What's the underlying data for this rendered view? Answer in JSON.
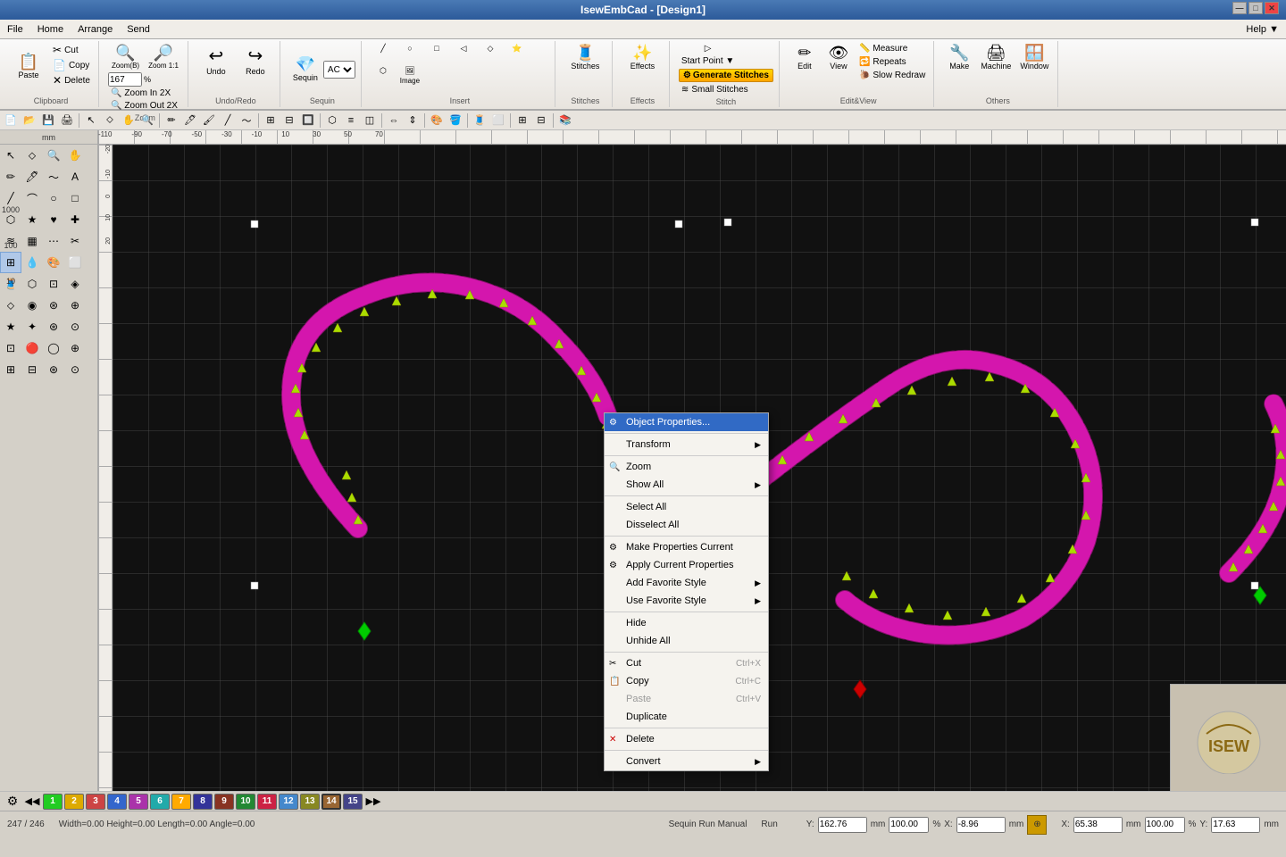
{
  "app": {
    "title": "IsewEmbCad - [Design1]",
    "coords": "247 / 246",
    "width_height": "Width=0.00  Height=0.00  Length=0.00  Angle=0.00",
    "mode": "Sequin Run Manual",
    "run": "Run"
  },
  "titlebar": {
    "title": "IsewEmbCad - [Design1]",
    "controls": [
      "—",
      "□",
      "✕"
    ]
  },
  "menubar": {
    "items": [
      "File",
      "Home",
      "Arrange",
      "Send"
    ]
  },
  "ribbon": {
    "clipboard": {
      "label": "Clipboard",
      "paste": "Paste",
      "cut": "Cut",
      "copy": "Copy",
      "delete": "Delete"
    },
    "zoom": {
      "label": "Zoom",
      "zoom_b": "Zoom(B)",
      "zoom_1_1": "Zoom\n1:1",
      "zoom_value": "167",
      "zoom_in": "Zoom In 2X",
      "zoom_out": "Zoom Out 2X"
    },
    "undo_redo": {
      "label": "Undo/Redo",
      "undo": "Undo",
      "redo": "Redo"
    },
    "sequin": {
      "label": "Sequin",
      "ac": "AC",
      "dropdown": "▼"
    },
    "insert": {
      "label": "Insert",
      "image": "Image"
    },
    "stitches": {
      "label": "Stitches",
      "stitches": "Stitches"
    },
    "effects": {
      "label": "Effects",
      "effects": "Effects"
    },
    "stitch": {
      "label": "Stitch",
      "start_point": "Start Point ▼",
      "generate": "Generate Stitches",
      "small_stitches": "Small Stitches"
    },
    "edit_view": {
      "label": "Edit&View",
      "edit": "Edit",
      "view": "View",
      "measure": "Measure",
      "repeats": "Repeats",
      "slow_redraw": "Slow Redraw"
    },
    "make_machine": {
      "label": "Others",
      "make": "Make",
      "machine": "Machine",
      "window": "Window"
    },
    "help": {
      "help": "Help ▼"
    }
  },
  "context_menu": {
    "items": [
      {
        "label": "Object Properties...",
        "shortcut": "",
        "has_arrow": false,
        "highlighted": true,
        "icon": "⚙"
      },
      {
        "label": "",
        "type": "sep"
      },
      {
        "label": "Transform",
        "shortcut": "",
        "has_arrow": true,
        "icon": ""
      },
      {
        "label": "",
        "type": "sep"
      },
      {
        "label": "Zoom",
        "shortcut": "",
        "has_arrow": false,
        "icon": "🔍"
      },
      {
        "label": "Show All",
        "shortcut": "",
        "has_arrow": true,
        "icon": ""
      },
      {
        "label": "",
        "type": "sep"
      },
      {
        "label": "Select All",
        "shortcut": "",
        "has_arrow": false,
        "icon": ""
      },
      {
        "label": "Disselect All",
        "shortcut": "",
        "has_arrow": false,
        "icon": ""
      },
      {
        "label": "",
        "type": "sep"
      },
      {
        "label": "Make Properties Current",
        "shortcut": "",
        "has_arrow": false,
        "icon": "⚙"
      },
      {
        "label": "Apply Current Properties",
        "shortcut": "",
        "has_arrow": false,
        "icon": "⚙"
      },
      {
        "label": "Add Favorite Style",
        "shortcut": "",
        "has_arrow": true,
        "icon": ""
      },
      {
        "label": "Use Favorite Style",
        "shortcut": "",
        "has_arrow": true,
        "icon": ""
      },
      {
        "label": "",
        "type": "sep"
      },
      {
        "label": "Hide",
        "shortcut": "",
        "has_arrow": false,
        "icon": ""
      },
      {
        "label": "Unhide All",
        "shortcut": "",
        "has_arrow": false,
        "icon": ""
      },
      {
        "label": "",
        "type": "sep"
      },
      {
        "label": "Cut",
        "shortcut": "Ctrl+X",
        "has_arrow": false,
        "icon": "✂"
      },
      {
        "label": "Copy",
        "shortcut": "Ctrl+C",
        "has_arrow": false,
        "icon": "📋"
      },
      {
        "label": "Paste",
        "shortcut": "Ctrl+V",
        "has_arrow": false,
        "icon": "",
        "disabled": true
      },
      {
        "label": "Duplicate",
        "shortcut": "",
        "has_arrow": false,
        "icon": ""
      },
      {
        "label": "",
        "type": "sep"
      },
      {
        "label": "Delete",
        "shortcut": "",
        "has_arrow": false,
        "icon": "✕"
      },
      {
        "label": "",
        "type": "sep"
      },
      {
        "label": "Convert",
        "shortcut": "",
        "has_arrow": true,
        "icon": ""
      }
    ]
  },
  "statusbar": {
    "coords": "247 / 246",
    "dimensions": "Width=0.00  Height=0.00  Length=0.00  Angle=0.00",
    "mode": "Sequin Run Manual",
    "run": "Run"
  },
  "color_row": {
    "colors": [
      {
        "num": "1",
        "color": "#22cc22"
      },
      {
        "num": "2",
        "color": "#ddaa00"
      },
      {
        "num": "3",
        "color": "#cc4444"
      },
      {
        "num": "4",
        "color": "#3366cc"
      },
      {
        "num": "5",
        "color": "#aa33aa"
      },
      {
        "num": "6",
        "color": "#22aaaa"
      },
      {
        "num": "7",
        "color": "#ffaa00"
      },
      {
        "num": "8",
        "color": "#333399"
      },
      {
        "num": "9",
        "color": "#883322"
      },
      {
        "num": "10",
        "color": "#228833"
      },
      {
        "num": "11",
        "color": "#cc2244"
      },
      {
        "num": "12",
        "color": "#4488cc"
      },
      {
        "num": "13",
        "color": "#888822"
      },
      {
        "num": "14",
        "color": "#996633"
      },
      {
        "num": "15",
        "color": "#444488"
      }
    ]
  },
  "coordinates": {
    "y_val": "162.76",
    "y_pct": "100.00",
    "x_val": "-8.96",
    "x2_val": "65.38",
    "x2_pct": "100.00",
    "y2_val": "17.63",
    "mm": "mm",
    "pct": "%"
  }
}
